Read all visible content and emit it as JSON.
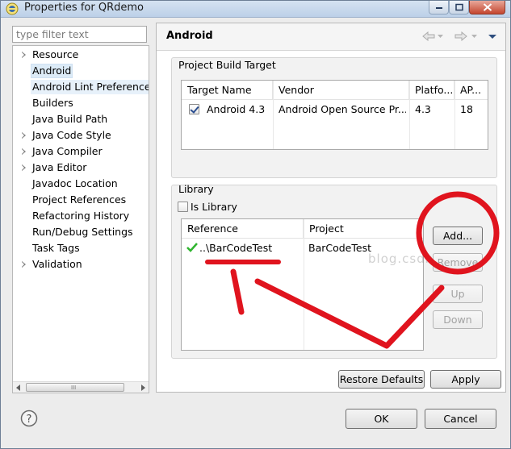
{
  "window": {
    "title": "Properties for QRdemo"
  },
  "sidebar": {
    "filter_placeholder": "type filter text",
    "items": [
      {
        "label": "Resource",
        "expandable": true
      },
      {
        "label": "Android",
        "expandable": false,
        "selected": true
      },
      {
        "label": "Android Lint Preferences",
        "expandable": false
      },
      {
        "label": "Builders",
        "expandable": false
      },
      {
        "label": "Java Build Path",
        "expandable": false
      },
      {
        "label": "Java Code Style",
        "expandable": true
      },
      {
        "label": "Java Compiler",
        "expandable": true
      },
      {
        "label": "Java Editor",
        "expandable": true
      },
      {
        "label": "Javadoc Location",
        "expandable": false
      },
      {
        "label": "Project References",
        "expandable": false
      },
      {
        "label": "Refactoring History",
        "expandable": false
      },
      {
        "label": "Run/Debug Settings",
        "expandable": false
      },
      {
        "label": "Task Tags",
        "expandable": false
      },
      {
        "label": "Validation",
        "expandable": true
      }
    ],
    "scroll_grip": "III"
  },
  "page": {
    "title": "Android",
    "build_target": {
      "group_title": "Project Build Target",
      "columns": [
        "Target Name",
        "Vendor",
        "Platfo...",
        "AP..."
      ],
      "rows": [
        {
          "checked": true,
          "name": "Android 4.3",
          "vendor": "Android Open Source Pr...",
          "platform": "4.3",
          "api": "18"
        }
      ]
    },
    "library": {
      "group_title": "Library",
      "is_library_label": "Is Library",
      "is_library_checked": false,
      "columns": [
        "Reference",
        "Project"
      ],
      "rows": [
        {
          "reference": "..\\BarCodeTest",
          "project": "BarCodeTest",
          "status": "ok"
        }
      ],
      "buttons": {
        "add": "Add...",
        "remove": "Remove",
        "up": "Up",
        "down": "Down"
      }
    },
    "watermark": "blog.csdn.net/",
    "restore_defaults": "Restore Defaults",
    "apply": "Apply"
  },
  "footer": {
    "ok": "OK",
    "cancel": "Cancel"
  },
  "colors": {
    "annotation_red": "#e0141e",
    "selection": "#dcebf7",
    "check_green": "#2fb52f"
  }
}
